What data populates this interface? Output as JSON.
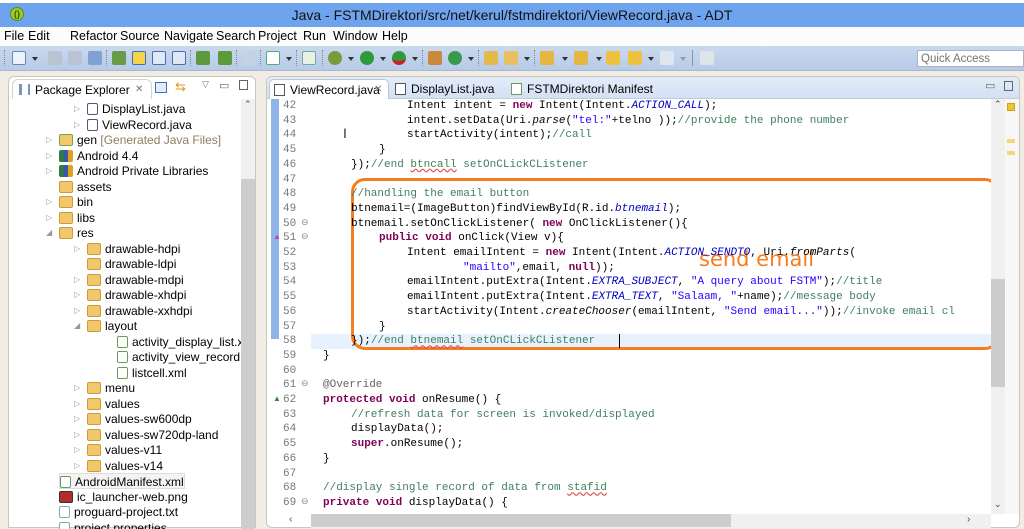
{
  "window": {
    "title": "Java - FSTMDirektori/src/net/kerul/fstmdirektori/ViewRecord.java - ADT",
    "app_icon": "adt-logo-icon"
  },
  "menu": [
    {
      "label": "File",
      "mnemonic": "F"
    },
    {
      "label": "Edit",
      "mnemonic": "E"
    },
    {
      "label": "Refactor",
      "mnemonic": ""
    },
    {
      "label": "Source",
      "mnemonic": "S"
    },
    {
      "label": "Navigate",
      "mnemonic": "N"
    },
    {
      "label": "Search",
      "mnemonic": "a"
    },
    {
      "label": "Project",
      "mnemonic": "P"
    },
    {
      "label": "Run",
      "mnemonic": "R"
    },
    {
      "label": "Window",
      "mnemonic": "W"
    },
    {
      "label": "Help",
      "mnemonic": "H"
    }
  ],
  "toolbar": {
    "icons": [
      "new-icon",
      "save-icon",
      "save-all-icon",
      "print-icon",
      "open-type-icon",
      "toggle-mark-occurrences-icon",
      "block-selection-icon",
      "show-whitespace-icon",
      "sdk-manager-icon",
      "avd-manager-icon",
      "skip-breakpoints-icon",
      "task-icon",
      "new-android-xml-icon",
      "debug-icon",
      "run-icon",
      "external-tools-icon",
      "new-java-package-icon",
      "new-java-class-icon",
      "open-project-icon",
      "pencil-icon",
      "next-annotation-icon",
      "prev-annotation-icon",
      "last-edit-icon",
      "back-icon",
      "forward-icon",
      "pin-editor-icon"
    ],
    "quick_access_placeholder": "Quick Access"
  },
  "package_explorer": {
    "title": "Package Explorer",
    "items": [
      {
        "label": "DisplayList.java",
        "icon": "java-file-warning-icon",
        "expanded": false
      },
      {
        "label": "ViewRecord.java",
        "icon": "java-file-warning-icon",
        "expanded": false
      },
      {
        "label": "gen",
        "suffix": "[Generated Java Files]",
        "icon": "source-folder-icon",
        "expanded": false
      },
      {
        "label": "Android 4.4",
        "icon": "library-icon",
        "expanded": false
      },
      {
        "label": "Android Private Libraries",
        "icon": "library-icon",
        "expanded": false
      },
      {
        "label": "assets",
        "icon": "folder-icon"
      },
      {
        "label": "bin",
        "icon": "folder-icon",
        "expanded": false
      },
      {
        "label": "libs",
        "icon": "folder-icon",
        "expanded": false
      },
      {
        "label": "res",
        "icon": "folder-warning-icon",
        "expanded": true
      },
      {
        "label": "drawable-hdpi",
        "icon": "folder-icon",
        "expanded": false
      },
      {
        "label": "drawable-ldpi",
        "icon": "folder-icon"
      },
      {
        "label": "drawable-mdpi",
        "icon": "folder-icon",
        "expanded": false
      },
      {
        "label": "drawable-xhdpi",
        "icon": "folder-icon",
        "expanded": false
      },
      {
        "label": "drawable-xxhdpi",
        "icon": "folder-icon",
        "expanded": false
      },
      {
        "label": "layout",
        "icon": "folder-warning-icon",
        "expanded": true
      },
      {
        "label": "activity_display_list.xml",
        "icon": "xml-file-icon"
      },
      {
        "label": "activity_view_record.xml",
        "icon": "xml-file-warning-icon"
      },
      {
        "label": "listcell.xml",
        "icon": "xml-file-icon"
      },
      {
        "label": "menu",
        "icon": "folder-icon",
        "expanded": false
      },
      {
        "label": "values",
        "icon": "folder-icon",
        "expanded": false
      },
      {
        "label": "values-sw600dp",
        "icon": "folder-icon",
        "expanded": false
      },
      {
        "label": "values-sw720dp-land",
        "icon": "folder-icon",
        "expanded": false
      },
      {
        "label": "values-v11",
        "icon": "folder-icon",
        "expanded": false
      },
      {
        "label": "values-v14",
        "icon": "folder-icon",
        "expanded": false
      },
      {
        "label": "AndroidManifest.xml",
        "icon": "manifest-warning-icon",
        "selected": true
      },
      {
        "label": "ic_launcher-web.png",
        "icon": "image-file-icon"
      },
      {
        "label": "proguard-project.txt",
        "icon": "text-file-icon"
      },
      {
        "label": "project.properties",
        "icon": "text-file-icon"
      }
    ]
  },
  "editor": {
    "tabs": [
      {
        "label": "ViewRecord.java",
        "active": true
      },
      {
        "label": "DisplayList.java",
        "active": false
      },
      {
        "label": "FSTMDirektori Manifest",
        "active": false
      }
    ],
    "lines": [
      {
        "n": "42",
        "code": "Intent intent = new Intent(Intent.ACTION_CALL);"
      },
      {
        "n": "43",
        "code": "intent.setData(Uri.parse(\"tel:\"+telno ));//provide the phone number"
      },
      {
        "n": "44",
        "code": "startActivity(intent);//call"
      },
      {
        "n": "45",
        "code": "}"
      },
      {
        "n": "46",
        "code": "});//end btncall setOnCLickCListener"
      },
      {
        "n": "47",
        "code": ""
      },
      {
        "n": "48",
        "code": "//handling the email button"
      },
      {
        "n": "49",
        "code": "btnemail=(ImageButton)findViewById(R.id.btnemail);"
      },
      {
        "n": "50",
        "code": "btnemail.setOnClickListener( new OnClickListener(){"
      },
      {
        "n": "51",
        "code": "public void onClick(View v){"
      },
      {
        "n": "52",
        "code": "Intent emailIntent = new Intent(Intent.ACTION_SENDTO, Uri.fromParts("
      },
      {
        "n": "53",
        "code": "\"mailto\",email, null));"
      },
      {
        "n": "54",
        "code": "emailIntent.putExtra(Intent.EXTRA_SUBJECT, \"A query about FSTM\");//title"
      },
      {
        "n": "55",
        "code": "emailIntent.putExtra(Intent.EXTRA_TEXT, \"Salaam, \"+name);//message body"
      },
      {
        "n": "56",
        "code": "startActivity(Intent.createChooser(emailIntent, \"Send email...\"));//invoke email cl"
      },
      {
        "n": "57",
        "code": "}"
      },
      {
        "n": "58",
        "code": "});//end btnemail setOnCLickCListener"
      },
      {
        "n": "59",
        "code": "}"
      },
      {
        "n": "60",
        "code": ""
      },
      {
        "n": "61",
        "code": "@Override"
      },
      {
        "n": "62",
        "code": "protected void onResume() {"
      },
      {
        "n": "63",
        "code": "//refresh data for screen is invoked/displayed"
      },
      {
        "n": "64",
        "code": "displayData();"
      },
      {
        "n": "65",
        "code": "super.onResume();"
      },
      {
        "n": "66",
        "code": "}"
      },
      {
        "n": "67",
        "code": ""
      },
      {
        "n": "68",
        "code": "//display single record of data from stafid"
      },
      {
        "n": "69",
        "code": "private void displayData() {"
      }
    ],
    "annotation_label": "send email",
    "annotation_color": "#f57d20",
    "current_line": "58"
  }
}
